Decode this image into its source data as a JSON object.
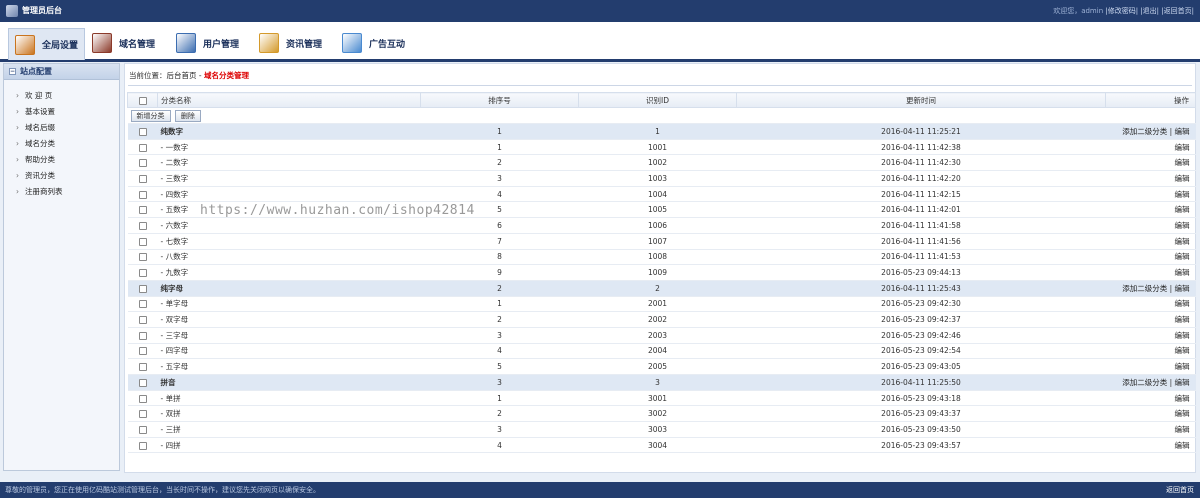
{
  "header": {
    "title": "管理员后台",
    "welcome": "欢迎您，admin",
    "change_pwd": "|修改密码|",
    "logout": "|退出|",
    "home": "|返回首页|"
  },
  "menu": [
    {
      "label": "全局设置",
      "icon": "gear-box-icon",
      "color": "#c9741e",
      "active": true
    },
    {
      "label": "域名管理",
      "icon": "grid-box-icon",
      "color": "#8b3a2a"
    },
    {
      "label": "用户管理",
      "icon": "user-card-icon",
      "color": "#3c6db0"
    },
    {
      "label": "资讯管理",
      "icon": "briefcase-icon",
      "color": "#d49a2b"
    },
    {
      "label": "广告互动",
      "icon": "window-icon",
      "color": "#4a8ad0"
    }
  ],
  "sidebar": {
    "title": "站点配置",
    "items": [
      "欢 迎 页",
      "基本设置",
      "域名后缀",
      "域名分类",
      "帮助分类",
      "资讯分类",
      "注册商列表"
    ]
  },
  "breadcrumb": {
    "prefix": "当前位置：",
    "home": "后台首页",
    "sep": " - ",
    "current": "域名分类管理"
  },
  "table": {
    "headers": [
      "分类名称",
      "排序号",
      "识别ID",
      "更新时间",
      "操作"
    ],
    "add_button": "新增分类",
    "delete_button": "删除",
    "add_sub_label": "添加二级分类",
    "op_sep": " | ",
    "edit_label": "编辑",
    "rows": [
      {
        "name": "纯数字",
        "sort": "1",
        "id": "1",
        "time": "2016-04-11 11:25:21",
        "parent": true
      },
      {
        "name": "- 一数字",
        "sort": "1",
        "id": "1001",
        "time": "2016-04-11 11:42:38"
      },
      {
        "name": "- 二数字",
        "sort": "2",
        "id": "1002",
        "time": "2016-04-11 11:42:30"
      },
      {
        "name": "- 三数字",
        "sort": "3",
        "id": "1003",
        "time": "2016-04-11 11:42:20"
      },
      {
        "name": "- 四数字",
        "sort": "4",
        "id": "1004",
        "time": "2016-04-11 11:42:15"
      },
      {
        "name": "- 五数字",
        "sort": "5",
        "id": "1005",
        "time": "2016-04-11 11:42:01"
      },
      {
        "name": "- 六数字",
        "sort": "6",
        "id": "1006",
        "time": "2016-04-11 11:41:58"
      },
      {
        "name": "- 七数字",
        "sort": "7",
        "id": "1007",
        "time": "2016-04-11 11:41:56"
      },
      {
        "name": "- 八数字",
        "sort": "8",
        "id": "1008",
        "time": "2016-04-11 11:41:53"
      },
      {
        "name": "- 九数字",
        "sort": "9",
        "id": "1009",
        "time": "2016-05-23 09:44:13"
      },
      {
        "name": "纯字母",
        "sort": "2",
        "id": "2",
        "time": "2016-04-11 11:25:43",
        "parent": true
      },
      {
        "name": "- 单字母",
        "sort": "1",
        "id": "2001",
        "time": "2016-05-23 09:42:30"
      },
      {
        "name": "- 双字母",
        "sort": "2",
        "id": "2002",
        "time": "2016-05-23 09:42:37"
      },
      {
        "name": "- 三字母",
        "sort": "3",
        "id": "2003",
        "time": "2016-05-23 09:42:46"
      },
      {
        "name": "- 四字母",
        "sort": "4",
        "id": "2004",
        "time": "2016-05-23 09:42:54"
      },
      {
        "name": "- 五字母",
        "sort": "5",
        "id": "2005",
        "time": "2016-05-23 09:43:05"
      },
      {
        "name": "拼音",
        "sort": "3",
        "id": "3",
        "time": "2016-04-11 11:25:50",
        "parent": true
      },
      {
        "name": "- 单拼",
        "sort": "1",
        "id": "3001",
        "time": "2016-05-23 09:43:18"
      },
      {
        "name": "- 双拼",
        "sort": "2",
        "id": "3002",
        "time": "2016-05-23 09:43:37"
      },
      {
        "name": "- 三拼",
        "sort": "3",
        "id": "3003",
        "time": "2016-05-23 09:43:50"
      },
      {
        "name": "- 四拼",
        "sort": "4",
        "id": "3004",
        "time": "2016-05-23 09:43:57"
      }
    ]
  },
  "watermark": "https://www.huzhan.com/ishop42814",
  "footer": {
    "notice": "尊敬的管理员，您正在使用亿码酷站测试管理后台，当长时间不操作，建议您先关闭网页以确保安全。",
    "home": "返回首页"
  }
}
